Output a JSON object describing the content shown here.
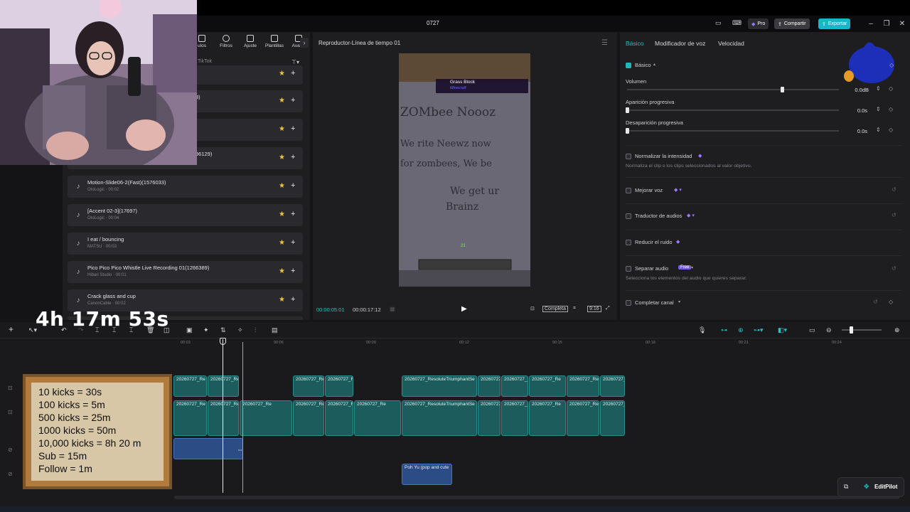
{
  "window": {
    "title": "0727",
    "pro_label": "Pro",
    "share_label": "Compartir",
    "export_label": "Exportar"
  },
  "assets": {
    "tabs": [
      "ulos",
      "Filtros",
      "Ajuste",
      "Plantillas",
      "Avatar"
    ],
    "search_tag": "TikTok",
    "partial_items": [
      "3)",
      "96129)"
    ],
    "items": [
      {
        "name": "Motion-Slide06-2(Fast)(1576033)",
        "sub": "OtoLogic · 00:02"
      },
      {
        "name": "[Accent 02-3](17697)",
        "sub": "OtoLogic · 00:04"
      },
      {
        "name": "I eat / bouncing",
        "sub": "MATSU · 00:03"
      },
      {
        "name": "Pico Pico Pico Whistle Live Recording 01(1266389)",
        "sub": "Hibari Studio · 00:01"
      },
      {
        "name": "Crack glass and cup",
        "sub": "CanonCable · 00:02"
      }
    ]
  },
  "player": {
    "title": "Reproductor-Línea de tiempo 01",
    "current_time": "00:00:05:01",
    "total_time": "00:00:17:12",
    "quality_label": "Completa",
    "ratio_label": "9:16",
    "game_tooltip": {
      "title": "Grass Block",
      "sub": "Minecraft"
    },
    "sign_lines": [
      "ZOMbee Noooz",
      "We rite Neewz now",
      "for zombees, We be",
      "We get ur",
      "Brainz"
    ],
    "hud_level": "21"
  },
  "inspector": {
    "tabs": [
      "Básico",
      "Modificador de voz",
      "Velocidad"
    ],
    "section": "Básico",
    "volume": {
      "label": "Volumen",
      "value": "0.0dB",
      "level": 0.73
    },
    "fade_in": {
      "label": "Aparición progresiva",
      "value": "0.0s",
      "level": 0.0
    },
    "fade_out": {
      "label": "Desaparición progresiva",
      "value": "0.0s",
      "level": 0.0
    },
    "normalize": {
      "label": "Normalizar la intensidad",
      "desc": "Normaliza el clip o los clips seleccionados al valor objetivo."
    },
    "enhance_voice": "Mejorar voz",
    "translate_audio": "Traductor de audios",
    "reduce_noise": "Reducir el ruido",
    "separate_audio": {
      "label": "Separar audio",
      "badge": "Free",
      "desc": "Selecciona los elementos del audio que quieres separar."
    },
    "complete_channel": "Completar canal"
  },
  "timeline": {
    "ruler": [
      "00:03",
      "00:06",
      "00:09",
      "00:12",
      "00:15",
      "00:18",
      "00:21",
      "00:24"
    ],
    "clip_name": "20260727_Re",
    "clip_name_long": "20260727_ResoluteTriumphantSe",
    "audio_clip": "Poh Yu (pop and cute",
    "editpilot": "EditPilot"
  },
  "overlay": {
    "timer": "4h 17m 53s",
    "kicks": [
      "10 kicks = 30s",
      "100 kicks = 5m",
      "500 kicks = 25m",
      "1000 kicks = 50m",
      "10,000 kicks = 8h 20 m",
      "Sub = 15m",
      "Follow = 1m"
    ]
  },
  "colors": {
    "accent": "#1fc2c0",
    "export": "#17b6c9",
    "audio_clip": "#2b4c84",
    "video_clip": "#1d5c5d"
  }
}
